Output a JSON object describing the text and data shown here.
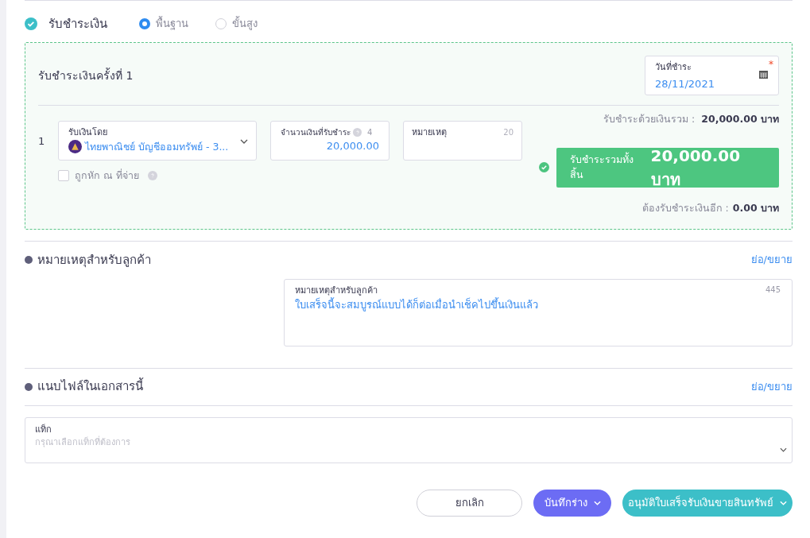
{
  "payment": {
    "title": "รับชำระเงิน",
    "checked": true,
    "modes": [
      {
        "label": "พื้นฐาน",
        "selected": true
      },
      {
        "label": "ขั้นสูง",
        "selected": false
      }
    ]
  },
  "installment": {
    "title": "รับชำระเงินครั้งที่ 1",
    "date": {
      "label": "วันที่ชำระ",
      "value": "28/11/2021",
      "required_mark": "*"
    },
    "row_number": "1",
    "received_by": {
      "label": "รับเงินโดย",
      "value": "ไทยพาณิชย์ บัญชีออมทรัพย์ - 3..."
    },
    "amount": {
      "label": "จำนวนเงินที่รับชำระ",
      "counter": "4",
      "value": "20,000.00"
    },
    "note": {
      "label": "หมายเหตุ",
      "counter": "20"
    },
    "withholding": {
      "label": "ถูกหัก ณ ที่จ่าย",
      "checked": false
    },
    "paid_total": {
      "label": "รับชำระด้วยเงินรวม :",
      "value": "20,000.00 บาท"
    },
    "grand_total": {
      "label": "รับชำระรวมทั้งสิ้น",
      "value": "20,000.00 บาท",
      "complete": true
    },
    "remaining": {
      "label": "ต้องรับชำระเงินอีก :",
      "value": "0.00 บาท"
    }
  },
  "customer_note": {
    "title": "หมายเหตุสำหรับลูกค้า",
    "toggle": "ย่อ/ขยาย",
    "field": {
      "label": "หมายเหตุสำหรับลูกค้า",
      "counter": "445",
      "value": "ใบเสร็จนี้จะสมบูรณ์แบบได้ก็ต่อเมื่อนำเช็คไปขึ้นเงินแล้ว"
    }
  },
  "attachments": {
    "title": "แนบไฟล์ในเอกสารนี้",
    "toggle": "ย่อ/ขยาย",
    "tag_field": {
      "label": "แท็ก",
      "placeholder": "กรุณาเลือกแท็กที่ต้องการ"
    }
  },
  "buttons": [
    {
      "label": "ยกเลิก",
      "kind": "outline"
    },
    {
      "label": "บันทึกร่าง",
      "kind": "draft"
    },
    {
      "label": "อนุมัติใบเสร็จรับเงินขายสินทรัพย์",
      "kind": "approve"
    }
  ]
}
